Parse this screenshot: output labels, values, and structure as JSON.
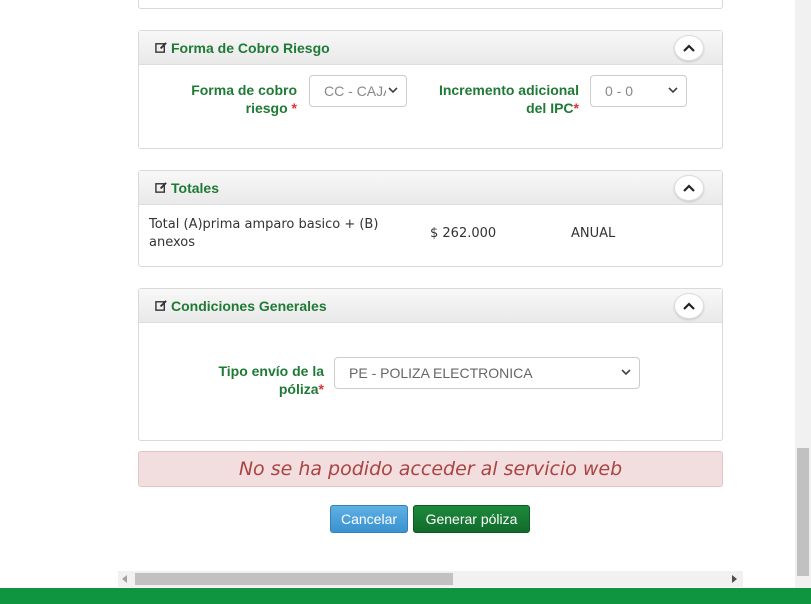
{
  "forma_cobro": {
    "title": "Forma de Cobro Riesgo",
    "field1_label_line1": "Forma de cobro",
    "field1_label_line2": "riesgo",
    "field1_value": "CC - CAJA",
    "field2_label_line1": "Incremento adicional",
    "field2_label_line2": "del IPC",
    "field2_value": "0 - 0",
    "required_mark": "*"
  },
  "totales": {
    "title": "Totales",
    "desc_line1": "Total (A)prima amparo basico + (B)",
    "desc_line2": "anexos",
    "amount": "$ 262.000",
    "period": "ANUAL"
  },
  "condiciones": {
    "title": "Condiciones Generales",
    "label_line1": "Tipo envío de la",
    "label_line2": "póliza",
    "value": "PE - POLIZA ELECTRONICA",
    "required_mark": "*"
  },
  "alert": {
    "message": "No se ha podido acceder al servicio web"
  },
  "buttons": {
    "cancel": "Cancelar",
    "generate": "Generar póliza"
  },
  "colors": {
    "label_green": "#1f7a35",
    "brand_green": "#0f9440",
    "alert_bg": "#f2dede",
    "alert_text": "#a94442",
    "cancel_blue": "#3a92cf"
  },
  "icons": {
    "panel_icon": "edit-icon",
    "collapse": "chevron-up-icon",
    "select_arrow": "chevron-down-icon"
  }
}
